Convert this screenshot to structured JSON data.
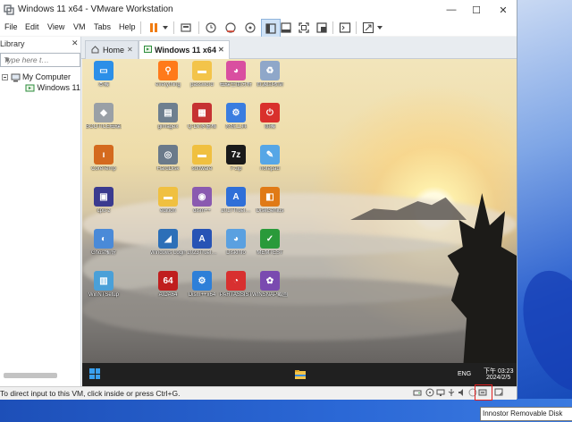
{
  "window": {
    "title": "Windows 11 x64 - VMware Workstation"
  },
  "window_controls": {
    "minimize": "—",
    "maximize": "☐",
    "close": "✕"
  },
  "menu": [
    {
      "label": "File"
    },
    {
      "label": "Edit"
    },
    {
      "label": "View"
    },
    {
      "label": "VM"
    },
    {
      "label": "Tabs"
    },
    {
      "label": "Help"
    }
  ],
  "library": {
    "title": "Library",
    "close": "✕",
    "search_placeholder": "Type here t…",
    "tree": [
      {
        "label": "My Computer"
      },
      {
        "label": "Windows 11"
      }
    ]
  },
  "tabs": [
    {
      "label": "Home"
    },
    {
      "label": "Windows 11 x64",
      "active": true
    }
  ],
  "tab_close": "✕",
  "guest_desktop": {
    "icons": [
      {
        "label": "本機",
        "color": "#2c8fe8",
        "glyph": "▭"
      },
      {
        "label": "everything",
        "color": "#ff7a1a",
        "glyph": "⚲"
      },
      {
        "label": "password",
        "color": "#f3c44a",
        "glyph": "▬"
      },
      {
        "label": "磁碟空間分析",
        "color": "#d94fa0",
        "glyph": "◕"
      },
      {
        "label": "資源回收筒",
        "color": "#8fa7c9",
        "glyph": "♻"
      },
      {
        "label": "BOOTICE磁碟工具",
        "color": "#9aa0a6",
        "glyph": "◆"
      },
      {
        "label": "gimagex",
        "color": "#6e7f8f",
        "glyph": "▤"
      },
      {
        "label": "Q-Dir多窗格",
        "color": "#c63232",
        "glyph": "▦"
      },
      {
        "label": "系統工具",
        "color": "#3a7de0",
        "glyph": "⚙"
      },
      {
        "label": "關機",
        "color": "#d9302c",
        "glyph": "⏻"
      },
      {
        "label": "CoreTemp",
        "color": "#d46a1e",
        "glyph": "ı"
      },
      {
        "label": "HardDisk",
        "color": "#6b7a8a",
        "glyph": "◎"
      },
      {
        "label": "software",
        "color": "#f0c040",
        "glyph": "▬"
      },
      {
        "label": "7-zip",
        "color": "#1a1a1a",
        "glyph": "7z"
      },
      {
        "label": "notepad",
        "color": "#56a6e6",
        "glyph": "✎"
      },
      {
        "label": "cpu-z",
        "color": "#3b3b8f",
        "glyph": "▣"
      },
      {
        "label": "edition",
        "color": "#f0c040",
        "glyph": "▬"
      },
      {
        "label": "dism++",
        "color": "#8a5ab0",
        "glyph": "◉"
      },
      {
        "label": "2017TrueI…",
        "color": "#2f6fd8",
        "glyph": "A"
      },
      {
        "label": "DiskGenius",
        "color": "#e07a16",
        "glyph": "◧"
      },
      {
        "label": "Ghost備份",
        "color": "#4a8ad8",
        "glyph": "◐"
      },
      {
        "label": "Windows Login…",
        "color": "#2c6fb8",
        "glyph": "◢"
      },
      {
        "label": "2023TrueI…",
        "color": "#2753b5",
        "glyph": "A"
      },
      {
        "label": "DiskInfo",
        "color": "#5aa0e0",
        "glyph": "◕"
      },
      {
        "label": "MEMTEST",
        "color": "#2a9a3a",
        "glyph": "✓"
      },
      {
        "label": "WinNTSetup",
        "color": "#4aa0d8",
        "glyph": "▥"
      },
      {
        "label": "AIDA64",
        "color": "#c01e1e",
        "glyph": "64"
      },
      {
        "label": "Dism++x64",
        "color": "#2e7fd8",
        "glyph": "⚙"
      },
      {
        "label": "PARTASSIST",
        "color": "#d83030",
        "glyph": "◔"
      },
      {
        "label": "WINSNAP截圖",
        "color": "#7a4ab0",
        "glyph": "✿"
      }
    ],
    "taskbar": {
      "lang": "ENG",
      "time": "下午 03:23",
      "date": "2024/2/5"
    }
  },
  "status_bar": {
    "message": "To direct input to this VM, click inside or press Ctrl+G."
  },
  "tooltip": {
    "text": "Innostor Removable Disk"
  },
  "colors": {
    "accent": "#f07c12",
    "active_tab_icon": "#2c8d3d",
    "highlight": "#e02020"
  }
}
